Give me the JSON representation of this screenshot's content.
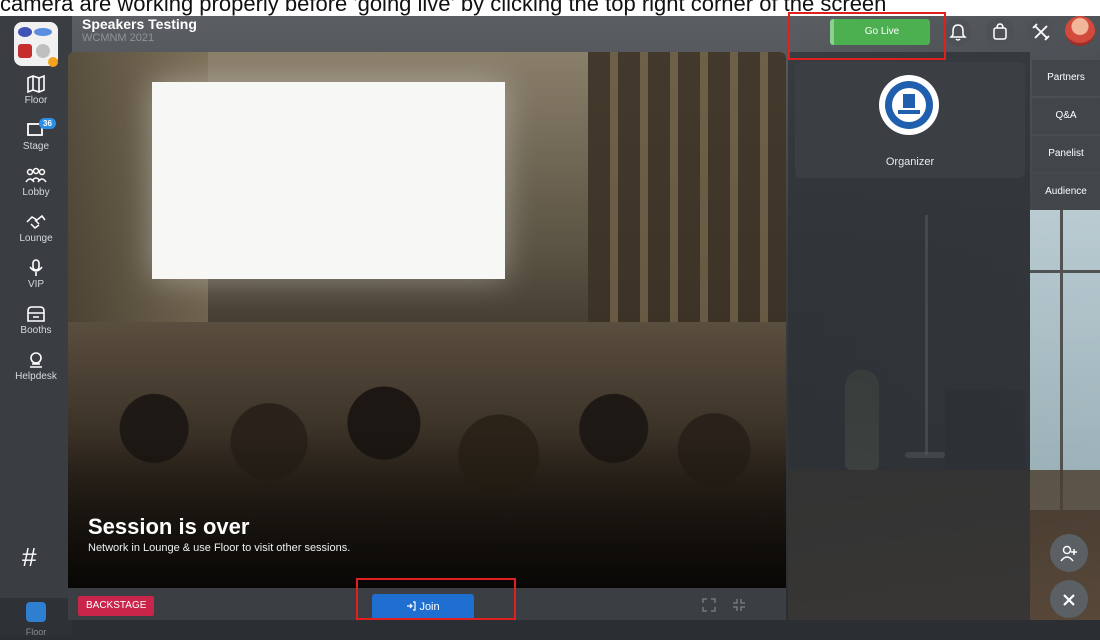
{
  "instruction_text": "camera are working properly before 'going live' by clicking the top right corner of the screen",
  "header": {
    "title": "Speakers Testing",
    "subtitle": "WCMNM 2021"
  },
  "sidebar": {
    "items": [
      {
        "label": "Floor",
        "icon": "map-icon"
      },
      {
        "label": "Stage",
        "icon": "stage-screen-icon",
        "badge": "36"
      },
      {
        "label": "Lobby",
        "icon": "people-group-icon"
      },
      {
        "label": "Lounge",
        "icon": "handshake-icon"
      },
      {
        "label": "VIP",
        "icon": "microphone-icon"
      },
      {
        "label": "Booths",
        "icon": "booth-icon"
      },
      {
        "label": "Helpdesk",
        "icon": "helpdesk-icon"
      }
    ],
    "hash_label": "#",
    "bottom_label": "Floor"
  },
  "stage": {
    "session_title": "Session is over",
    "session_subtitle": "Network in Lounge & use Floor to visit other sessions."
  },
  "bottom_bar": {
    "backstage_label": "BACKSTAGE",
    "join_label": "Join",
    "join_icon": "login-arrow-icon"
  },
  "top_controls": {
    "go_live_label": "Go Live",
    "icons": [
      "bell-icon",
      "shopping-bag-icon",
      "tools-icon"
    ],
    "avatar": "user-avatar"
  },
  "right_panel": {
    "organizer_label": "Organizer",
    "tabs": [
      "Partners",
      "Q&A",
      "Panelist",
      "Audience"
    ]
  },
  "fabs": {
    "add_person_icon": "add-person-icon",
    "close_icon": "close-icon"
  },
  "colors": {
    "go_live": "#4caf50",
    "join": "#1e6fcf",
    "backstage": "#c9244a",
    "highlight": "#e01f1f"
  }
}
